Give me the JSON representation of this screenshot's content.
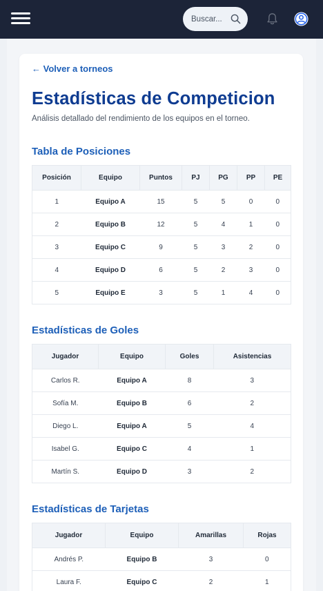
{
  "header": {
    "search_placeholder": "Buscar..."
  },
  "nav": {
    "back_label": "← Volver a torneos"
  },
  "page": {
    "title": "Estadísticas de Competicion",
    "subtitle": "Análisis detallado del rendimiento de los equipos en el torneo."
  },
  "standings": {
    "title": "Tabla de Posiciones",
    "headers": [
      "Posición",
      "Equipo",
      "Puntos",
      "PJ",
      "PG",
      "PP",
      "PE"
    ],
    "rows": [
      [
        "1",
        "Equipo A",
        "15",
        "5",
        "5",
        "0",
        "0"
      ],
      [
        "2",
        "Equipo B",
        "12",
        "5",
        "4",
        "1",
        "0"
      ],
      [
        "3",
        "Equipo C",
        "9",
        "5",
        "3",
        "2",
        "0"
      ],
      [
        "4",
        "Equipo D",
        "6",
        "5",
        "2",
        "3",
        "0"
      ],
      [
        "5",
        "Equipo E",
        "3",
        "5",
        "1",
        "4",
        "0"
      ]
    ]
  },
  "goals": {
    "title": "Estadísticas de Goles",
    "headers": [
      "Jugador",
      "Equipo",
      "Goles",
      "Asistencias"
    ],
    "rows": [
      [
        "Carlos R.",
        "Equipo A",
        "8",
        "3"
      ],
      [
        "Sofía M.",
        "Equipo B",
        "6",
        "2"
      ],
      [
        "Diego L.",
        "Equipo A",
        "5",
        "4"
      ],
      [
        "Isabel G.",
        "Equipo C",
        "4",
        "1"
      ],
      [
        "Martín S.",
        "Equipo D",
        "3",
        "2"
      ]
    ]
  },
  "cards": {
    "title": "Estadísticas de Tarjetas",
    "headers": [
      "Jugador",
      "Equipo",
      "Amarillas",
      "Rojas"
    ],
    "rows": [
      [
        "Andrés P.",
        "Equipo B",
        "3",
        "0"
      ],
      [
        "Laura F.",
        "Equipo C",
        "2",
        "1"
      ]
    ]
  }
}
